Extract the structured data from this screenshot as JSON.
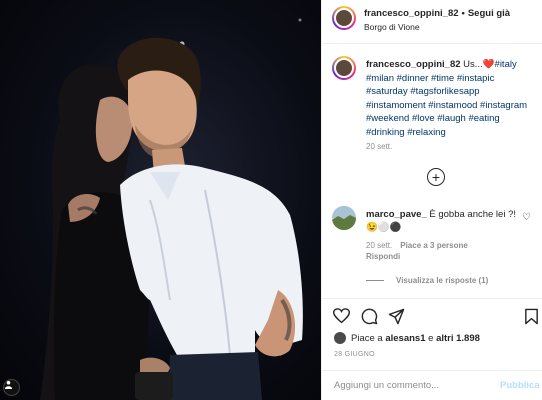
{
  "post": {
    "username": "francesco_oppini_82",
    "follow_status": "Segui già",
    "location": "Borgo di Vione",
    "caption_prefix": "Us...",
    "caption_hashtags": "#italy #milan #dinner #time #instapic #saturday #tagsforlikesapp #instamoment #instamood #instagram #weekend #love #laugh #eating #drinking #relaxing",
    "caption_time": "20 sett.",
    "heart_emoji": "❤️"
  },
  "comment": {
    "username": "marco_pave_",
    "text": "È gobba anche lei ?!",
    "emojis": "😉⚪⚫",
    "time": "20 sett.",
    "likes": "Piace a 3 persone",
    "reply_label": "Rispondi",
    "view_replies": "Visualizza le risposte (1)"
  },
  "likes": {
    "prefix": "Piace a",
    "user": "alesans1",
    "middle": "e",
    "others": "altri 1.898"
  },
  "date": "28 GIUGNO",
  "add_comment": {
    "placeholder": "Aggiungi un commento...",
    "publish_label": "Pubblica"
  },
  "icons": [
    "heart-outline-icon",
    "comment-icon",
    "share-icon",
    "bookmark-icon",
    "plus-circle-icon",
    "user-tag-icon"
  ],
  "colors": {
    "link": "#00376b",
    "secondary": "#8e8e8e",
    "publish_disabled": "#b2dffc",
    "heart": "#ed4956"
  }
}
